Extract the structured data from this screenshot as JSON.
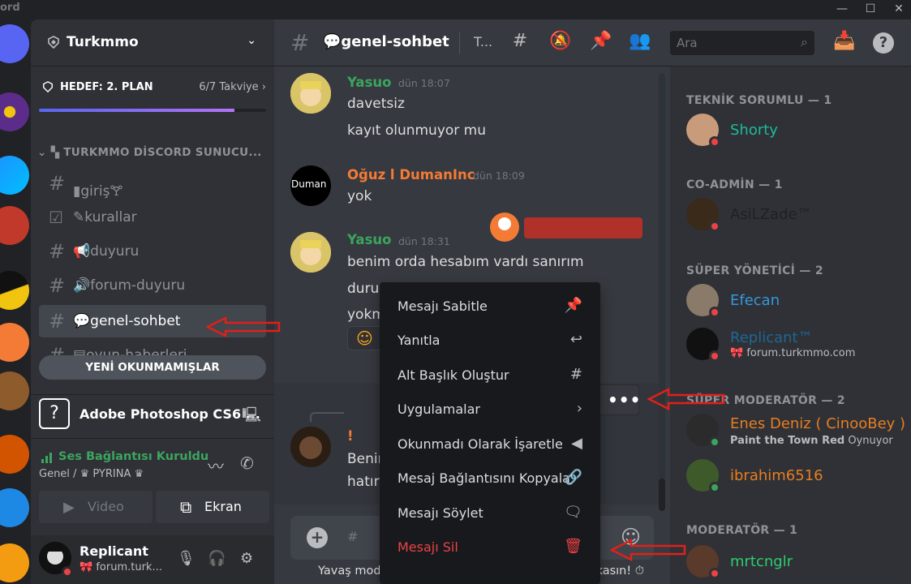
{
  "app": {
    "brand": "ord"
  },
  "server": {
    "name": "Turkmmo"
  },
  "goal": {
    "label": "HEDEF: 2. PLAN",
    "count": "6/7 Takviye",
    "progress": 0.86
  },
  "category": {
    "label": "TURKMMO DİSCORD SUNUCU..."
  },
  "channels": [
    {
      "name": "giriş"
    },
    {
      "name": "kurallar"
    },
    {
      "name": "duyuru"
    },
    {
      "name": "forum-duyuru"
    },
    {
      "name": "genel-sohbet"
    },
    {
      "name": "oyun-haberleri"
    }
  ],
  "unread_pill": "YENİ OKUNMAMIŞLAR",
  "activity": {
    "title": "Adobe Photoshop CS6 ..."
  },
  "voice": {
    "status": "Ses Bağlantısı Kuruldu",
    "channel": "Genel / ♛ PYRINA ♛",
    "video_label": "Video",
    "screen_label": "Ekran"
  },
  "user": {
    "name": "Replicant",
    "status": "forum.turk..."
  },
  "header": {
    "channel": "genel-sohbet",
    "topic": "T...",
    "search_placeholder": "Ara"
  },
  "messages": [
    {
      "user": "Yasuo",
      "time": "dün 18:07",
      "lines": [
        "davetsiz",
        "kayıt olunmuyor mu"
      ],
      "color": "#3ba55d"
    },
    {
      "user": "Oğuz l DumanInc",
      "time": "dün 18:09",
      "lines": [
        "yok"
      ],
      "color": "#f47b36"
    },
    {
      "user": "Yasuo",
      "time": "dün 18:31",
      "lines": [
        "benim orda hesabım vardı sanırım",
        "duru",
        "yokm"
      ],
      "color": "#3ba55d"
    },
    {
      "user": "!",
      "time": "",
      "lines": [
        "Benim",
        "hatırl"
      ],
      "color": "#f47b36"
    }
  ],
  "avatar_text": {
    "duman": "Duman"
  },
  "composer": {
    "placeholder": "#"
  },
  "slowmode": "Yavaş mod açıldı, ama bu seni etkilemiyor. Harikasın!",
  "context_menu": [
    {
      "label": "Mesajı Sabitle",
      "icon": "pin-icon"
    },
    {
      "label": "Yanıtla",
      "icon": "reply-icon"
    },
    {
      "label": "Alt Başlık Oluştur",
      "icon": "thread-icon"
    },
    {
      "label": "Uygulamalar",
      "icon": "chevron-right-icon"
    },
    {
      "label": "Okunmadı Olarak İşaretle",
      "icon": "unread-flag-icon"
    },
    {
      "label": "Mesaj Bağlantısını Kopyala",
      "icon": "link-icon"
    },
    {
      "label": "Mesajı Söylet",
      "icon": "speak-icon"
    },
    {
      "label": "Mesajı Sil",
      "icon": "trash-icon"
    }
  ],
  "members": {
    "roles": [
      {
        "label": "TEKNİK SORUMLU — 1"
      },
      {
        "label": "CO-ADMİN — 1"
      },
      {
        "label": "SÜPER YÖNETİCİ — 2"
      },
      {
        "label": "SÜPER MODERATÖR — 2"
      },
      {
        "label": "MODERATÖR — 1"
      }
    ],
    "list": [
      {
        "name": "Shorty",
        "color": "#1abc9c"
      },
      {
        "name": "AsiLZade™",
        "color": "#2c2f33"
      },
      {
        "name": "Efecan",
        "color": "#3498db"
      },
      {
        "name": "Replicant™",
        "color": "#206694",
        "sub": "forum.turkmmo.com"
      },
      {
        "name": "Enes Deniz ( CinooBey )",
        "color": "#e67e22",
        "sub_bold": "Paint the Town Red",
        "sub": "Oynuyor"
      },
      {
        "name": "ibrahim6516",
        "color": "#e67e22"
      },
      {
        "name": "mrtcnglr",
        "color": "#2ecc71"
      }
    ]
  },
  "colors": {
    "accent": "#5865f2",
    "online": "#3ba55d",
    "dnd": "#ed4245",
    "arrow": "#e0201b"
  }
}
